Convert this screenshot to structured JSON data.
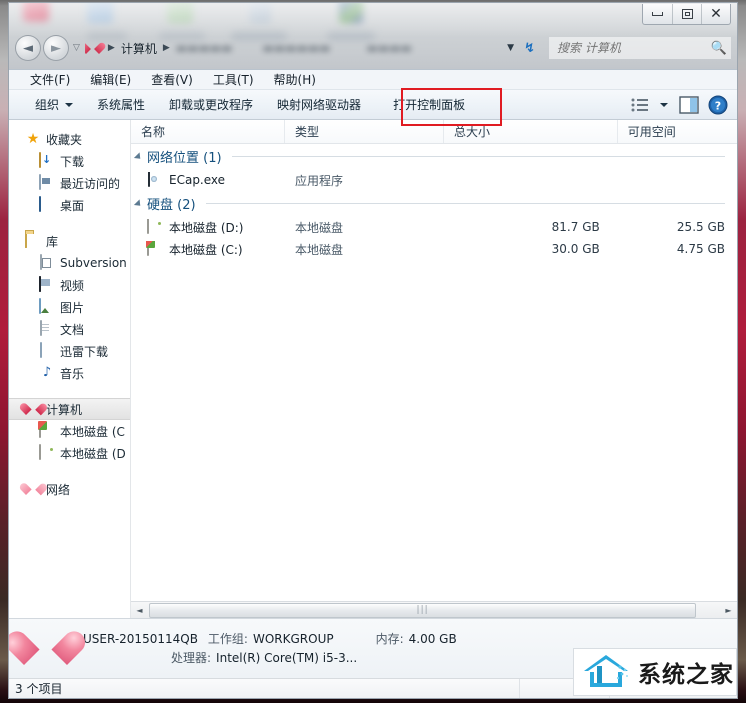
{
  "window": {
    "controls": [
      {
        "name": "minimize",
        "glyph": "minimize-icon"
      },
      {
        "name": "maximize",
        "glyph": "maximize-icon"
      },
      {
        "name": "close",
        "glyph": "close-icon"
      }
    ]
  },
  "addressbar": {
    "back_glyph": "◄",
    "forward_glyph": "►",
    "history_glyph": "▽",
    "crumb_home_icon": "heart-icon",
    "crumb_current": "计算机",
    "crumb_sep": "▶",
    "dropdown_glyph": "▼",
    "refresh_glyph": "↯",
    "blurred_crumb_1": "▬▬▬▬▬",
    "blurred_crumb_2": "▬▬▬▬▬▬",
    "blurred_crumb_3": "▬▬▬▬"
  },
  "search": {
    "placeholder": "搜索 计算机",
    "value": "",
    "icon": "search-icon"
  },
  "menubar": {
    "items": [
      {
        "label": "文件(F)",
        "name": "menu-file"
      },
      {
        "label": "编辑(E)",
        "name": "menu-edit"
      },
      {
        "label": "查看(V)",
        "name": "menu-view"
      },
      {
        "label": "工具(T)",
        "name": "menu-tools"
      },
      {
        "label": "帮助(H)",
        "name": "menu-help"
      }
    ]
  },
  "toolbar": {
    "organize": "组织",
    "buttons": [
      {
        "label": "系统属性",
        "name": "toolbar-system-properties"
      },
      {
        "label": "卸载或更改程序",
        "name": "toolbar-uninstall-change-program"
      },
      {
        "label": "映射网络驱动器",
        "name": "toolbar-map-network-drive"
      },
      {
        "label": "打开控制面板",
        "name": "toolbar-open-control-panel",
        "highlighted": true
      }
    ],
    "highlight_color": "#e01b22",
    "view_icon": "view-options-icon",
    "view_caret": "▼",
    "preview_icon": "preview-pane-icon",
    "help_icon": "help-icon"
  },
  "navpane": {
    "groups": [
      {
        "root": {
          "label": "收藏夹",
          "icon": "star-icon",
          "name": "nav-favorites"
        },
        "children": [
          {
            "label": "下载",
            "icon": "downloads-icon",
            "name": "nav-downloads"
          },
          {
            "label": "最近访问的",
            "icon": "recent-places-icon",
            "name": "nav-recent-places"
          },
          {
            "label": "桌面",
            "icon": "desktop-icon",
            "name": "nav-desktop"
          }
        ]
      },
      {
        "root": {
          "label": "库",
          "icon": "library-icon",
          "name": "nav-libraries"
        },
        "children": [
          {
            "label": "Subversion",
            "icon": "subversion-icon",
            "name": "nav-subversion"
          },
          {
            "label": "视频",
            "icon": "video-icon",
            "name": "nav-videos"
          },
          {
            "label": "图片",
            "icon": "picture-icon",
            "name": "nav-pictures"
          },
          {
            "label": "文档",
            "icon": "document-icon",
            "name": "nav-documents"
          },
          {
            "label": "迅雷下载",
            "icon": "thunder-download-icon",
            "name": "nav-thunder-download"
          },
          {
            "label": "音乐",
            "icon": "music-icon",
            "name": "nav-music"
          }
        ]
      },
      {
        "root": {
          "label": "计算机",
          "icon": "computer-heart-icon",
          "name": "nav-computer",
          "selected": true
        },
        "children": [
          {
            "label": "本地磁盘 (C",
            "icon": "system-drive-icon",
            "name": "nav-drive-c"
          },
          {
            "label": "本地磁盘 (D",
            "icon": "drive-icon",
            "name": "nav-drive-d"
          }
        ]
      },
      {
        "root": {
          "label": "网络",
          "icon": "network-heart-icon",
          "name": "nav-network"
        },
        "children": []
      }
    ]
  },
  "filelist": {
    "columns": [
      {
        "label": "名称",
        "name": "column-name"
      },
      {
        "label": "类型",
        "name": "column-type"
      },
      {
        "label": "总大小",
        "name": "column-total-size"
      },
      {
        "label": "可用空间",
        "name": "column-free-space"
      }
    ],
    "groups": [
      {
        "header": "网络位置 (1)",
        "name": "group-network-locations",
        "rows": [
          {
            "name": "ECap.exe",
            "type": "应用程序",
            "size": "",
            "free": "",
            "icon": "exe-icon"
          }
        ]
      },
      {
        "header": "硬盘 (2)",
        "name": "group-hard-disks",
        "rows": [
          {
            "name": "本地磁盘 (D:)",
            "type": "本地磁盘",
            "size": "81.7 GB",
            "free": "25.5 GB",
            "icon": "drive-icon"
          },
          {
            "name": "本地磁盘 (C:)",
            "type": "本地磁盘",
            "size": "30.0 GB",
            "free": "4.75 GB",
            "icon": "system-drive-icon"
          }
        ]
      }
    ],
    "scrollbar": {
      "left_arrow": "◄",
      "right_arrow": "►",
      "grip": "|||"
    }
  },
  "details": {
    "icon": "computer-heart-icon",
    "computer_name": "USER-20150114QB",
    "workgroup_label": "工作组:",
    "workgroup_value": "WORKGROUP",
    "memory_label": "内存:",
    "memory_value": "4.00 GB",
    "processor_label": "处理器:",
    "processor_value": "Intel(R) Core(TM) i5-3..."
  },
  "statusbar": {
    "items_count": "3 个项目"
  },
  "watermark": {
    "text": "系统之家",
    "logo": "house-speed-logo-icon",
    "logo_color": "#29a8dc"
  }
}
